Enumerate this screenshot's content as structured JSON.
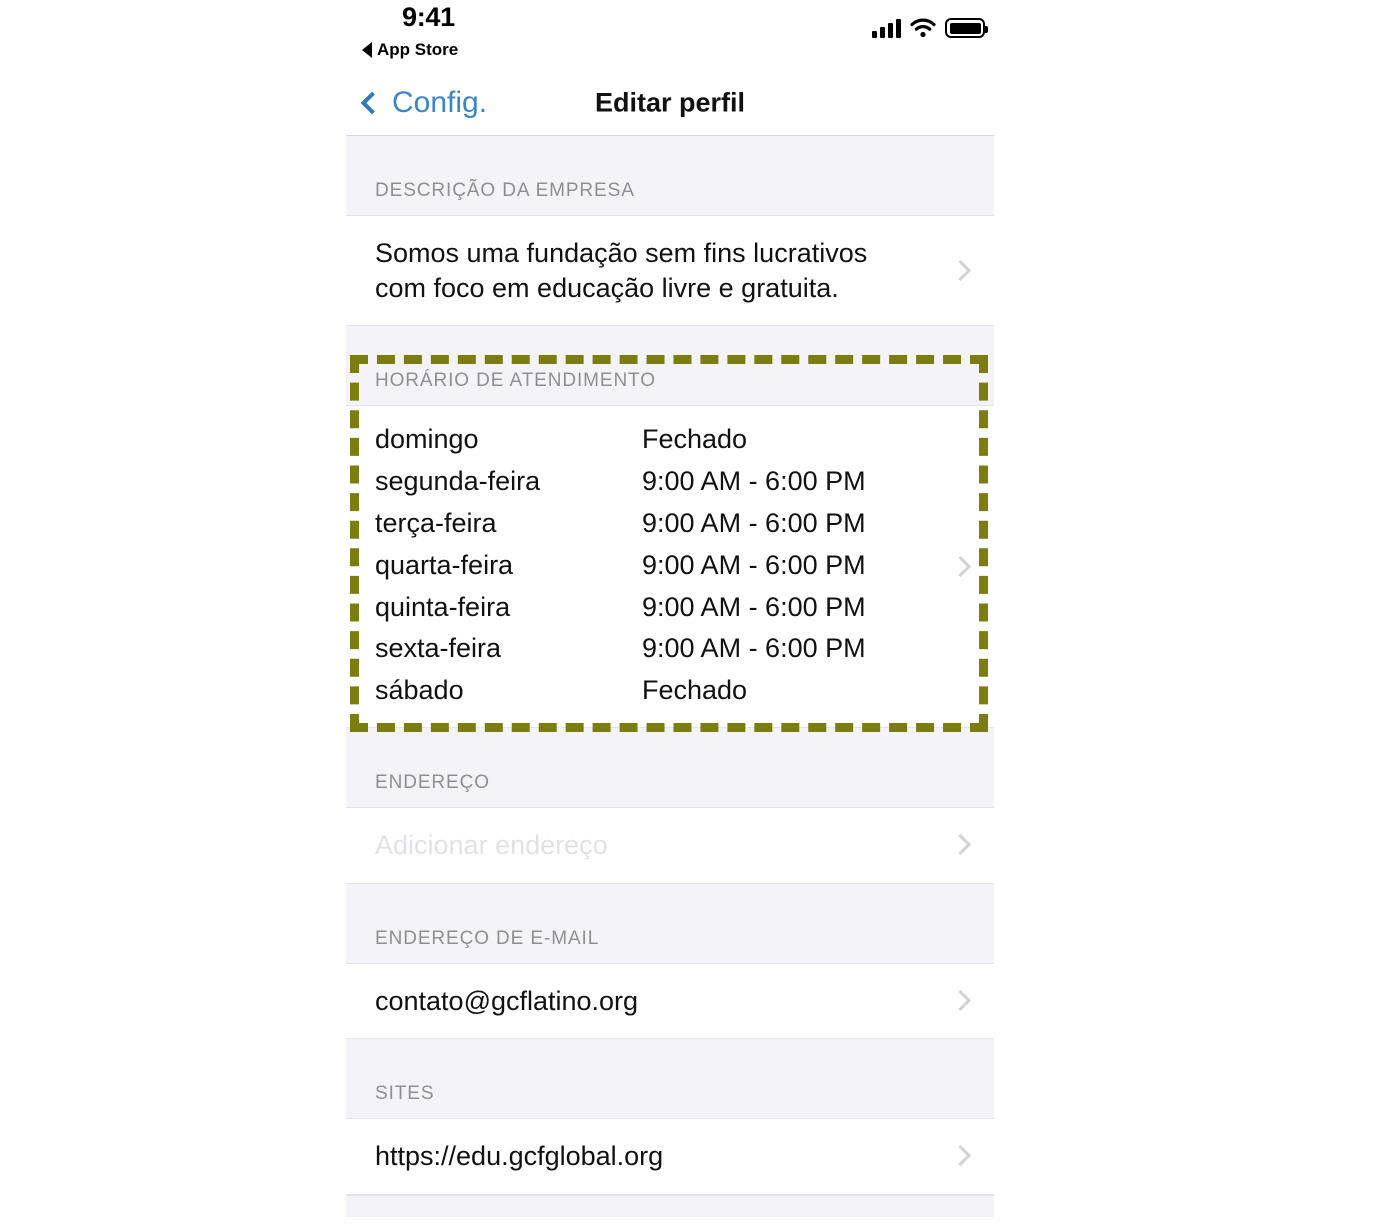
{
  "status_bar": {
    "time": "9:41",
    "return_label": "App Store",
    "signal_icon": "cellular-signal-icon",
    "wifi_icon": "wifi-icon",
    "battery_icon": "battery-full-icon"
  },
  "nav_bar": {
    "back_label": "Config.",
    "back_icon": "chevron-left-icon",
    "title": "Editar perfil"
  },
  "sections": {
    "description": {
      "header": "DESCRIÇÃO DA EMPRESA",
      "value": "Somos uma fundação sem fins lucrativos com foco em educação livre e gratuita.",
      "chevron_icon": "chevron-right-icon"
    },
    "hours": {
      "header": "HORÁRIO DE ATENDIMENTO",
      "chevron_icon": "chevron-right-icon",
      "rows": [
        {
          "day": "domingo",
          "time": "Fechado"
        },
        {
          "day": "segunda-feira",
          "time": "9:00 AM - 6:00 PM"
        },
        {
          "day": "terça-feira",
          "time": "9:00 AM - 6:00 PM"
        },
        {
          "day": "quarta-feira",
          "time": "9:00 AM - 6:00 PM"
        },
        {
          "day": "quinta-feira",
          "time": "9:00 AM - 6:00 PM"
        },
        {
          "day": "sexta-feira",
          "time": "9:00 AM - 6:00 PM"
        },
        {
          "day": "sábado",
          "time": "Fechado"
        }
      ]
    },
    "address": {
      "header": "ENDEREÇO",
      "placeholder": "Adicionar endereço",
      "chevron_icon": "chevron-right-icon"
    },
    "email": {
      "header": "ENDEREÇO DE E-MAIL",
      "value": "contato@gcflatino.org",
      "chevron_icon": "chevron-right-icon"
    },
    "sites": {
      "header": "SITES",
      "value": "https://edu.gcfglobal.org",
      "chevron_icon": "chevron-right-icon"
    }
  },
  "annotation": {
    "highlight_color": "#7c7d10",
    "target": "hours"
  },
  "colors": {
    "accent_blue": "#3b86c4",
    "section_bg": "#f4f4f8",
    "row_bg": "#ffffff",
    "muted_text": "#8e8e93",
    "placeholder_text": "#e2e2e6",
    "chevron": "#d2d2d7"
  }
}
